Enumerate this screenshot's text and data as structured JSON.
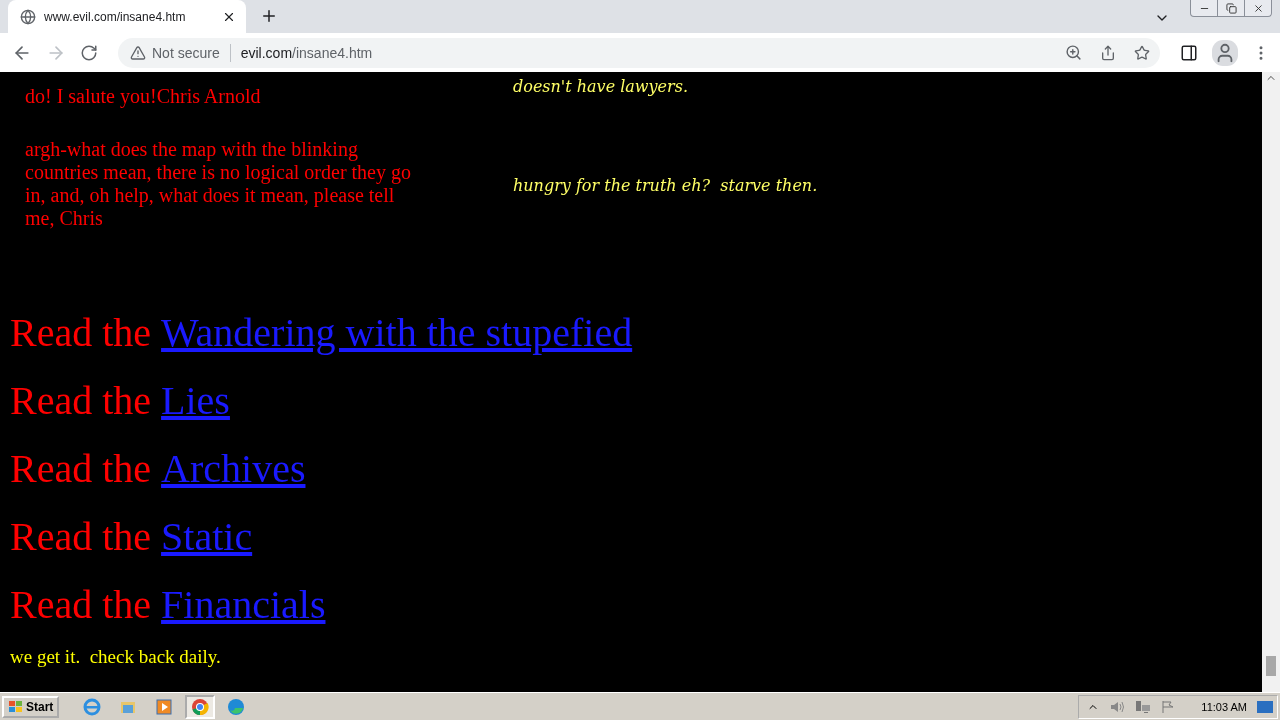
{
  "browser": {
    "tab": {
      "title": "www.evil.com/insane4.htm",
      "selected": true
    },
    "security": "Not secure",
    "url_host": "evil.com",
    "url_path": "/insane4.htm"
  },
  "page": {
    "left_column": [
      "do! I salute you!Chris Arnold",
      "argh-what does the map with the blinking countries mean, there is no logical order they go in, and, oh help, what does it mean, please tell me, Chris"
    ],
    "right_column": [
      "doesn't have lawyers.",
      "hungry for the truth eh?  starve then."
    ],
    "reads": [
      {
        "prefix": "Read the",
        "link": "Wandering with the stupefied"
      },
      {
        "prefix": "Read the",
        "link": "Lies"
      },
      {
        "prefix": "Read the",
        "link": "Archives"
      },
      {
        "prefix": "Read the",
        "link": "Static"
      },
      {
        "prefix": "Read the",
        "link": "Financials"
      }
    ],
    "footer": "we get it.  check back daily."
  },
  "taskbar": {
    "start": "Start",
    "apps": [
      {
        "kind": "ie",
        "selected": false
      },
      {
        "kind": "folder",
        "selected": false
      },
      {
        "kind": "media",
        "selected": false
      },
      {
        "kind": "chrome",
        "selected": true
      },
      {
        "kind": "edge",
        "selected": false
      }
    ],
    "clock": "11:03 AM"
  }
}
